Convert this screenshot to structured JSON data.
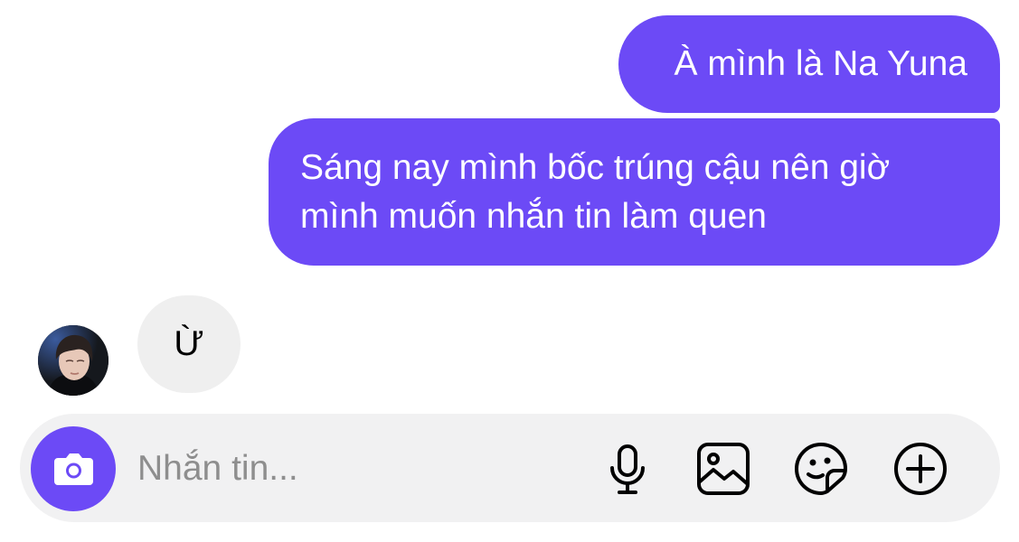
{
  "conversation": {
    "messages": [
      {
        "direction": "outgoing",
        "lines": [
          "À mình là Na Yuna"
        ]
      },
      {
        "direction": "outgoing",
        "lines": [
          "Sáng nay mình bốc trúng cậu nên giờ",
          "mình muốn nhắn tin làm quen"
        ]
      },
      {
        "direction": "incoming",
        "lines": [
          "Ừ"
        ]
      }
    ]
  },
  "composer": {
    "placeholder": "Nhắn tin...",
    "icons": {
      "camera": "camera-icon",
      "microphone": "microphone-icon",
      "gallery": "gallery-icon",
      "sticker": "sticker-icon",
      "more": "plus-circle-icon"
    }
  },
  "colors": {
    "outgoing_bubble": "#6c4af6",
    "incoming_bubble": "#efefef",
    "composer_background": "#f1f1f2",
    "accent": "#6c4af6"
  }
}
